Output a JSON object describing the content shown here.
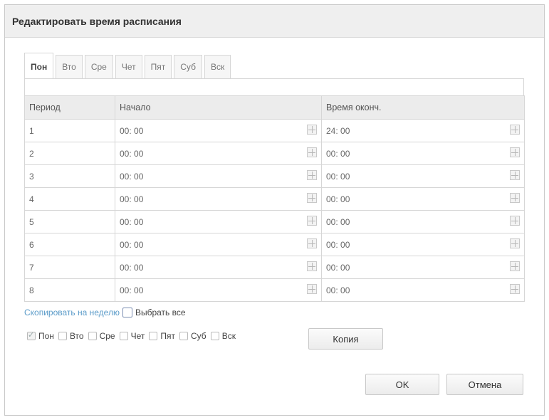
{
  "dialog": {
    "title": "Редактировать время расписания"
  },
  "tabs": [
    {
      "label": "Пон",
      "active": true
    },
    {
      "label": "Вто",
      "active": false
    },
    {
      "label": "Сре",
      "active": false
    },
    {
      "label": "Чет",
      "active": false
    },
    {
      "label": "Пят",
      "active": false
    },
    {
      "label": "Суб",
      "active": false
    },
    {
      "label": "Вск",
      "active": false
    }
  ],
  "table": {
    "headers": [
      "Период",
      "Начало",
      "Время оконч."
    ],
    "rows": [
      {
        "period": "1",
        "start": "00: 00",
        "end": "24: 00"
      },
      {
        "period": "2",
        "start": "00: 00",
        "end": "00: 00"
      },
      {
        "period": "3",
        "start": "00: 00",
        "end": "00: 00"
      },
      {
        "period": "4",
        "start": "00: 00",
        "end": "00: 00"
      },
      {
        "period": "5",
        "start": "00: 00",
        "end": "00: 00"
      },
      {
        "period": "6",
        "start": "00: 00",
        "end": "00: 00"
      },
      {
        "period": "7",
        "start": "00: 00",
        "end": "00: 00"
      },
      {
        "period": "8",
        "start": "00: 00",
        "end": "00: 00"
      }
    ]
  },
  "copy": {
    "link_label": "Скопировать на неделю",
    "select_all_label": "Выбрать все",
    "days": [
      {
        "label": "Пон",
        "checked": true
      },
      {
        "label": "Вто",
        "checked": false
      },
      {
        "label": "Сре",
        "checked": false
      },
      {
        "label": "Чет",
        "checked": false
      },
      {
        "label": "Пят",
        "checked": false
      },
      {
        "label": "Суб",
        "checked": false
      },
      {
        "label": "Вск",
        "checked": false
      }
    ],
    "copy_button": "Копия"
  },
  "footer": {
    "ok": "OK",
    "cancel": "Отмена"
  },
  "colors": {
    "link": "#5a9bc9",
    "header_bg": "#ececec",
    "title_bg": "#efefef"
  }
}
